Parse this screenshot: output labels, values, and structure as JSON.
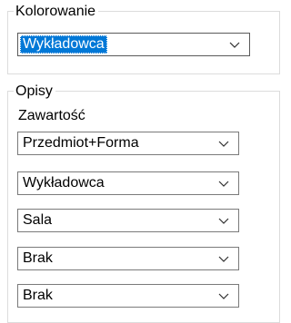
{
  "coloring_group": {
    "title": "Kolorowanie",
    "selected": "Wykładowca",
    "arrow_icon": "chevron-down-icon"
  },
  "descriptions_group": {
    "title": "Opisy",
    "content_label": "Zawartość",
    "combos": [
      {
        "value": "Przedmiot+Forma"
      },
      {
        "value": "Wykładowca"
      },
      {
        "value": "Sala"
      },
      {
        "value": "Brak"
      },
      {
        "value": "Brak"
      }
    ]
  },
  "colors": {
    "selection_highlight": "#0078d7",
    "group_border": "#dcdcdc",
    "combo_border": "#7a7a7a"
  }
}
